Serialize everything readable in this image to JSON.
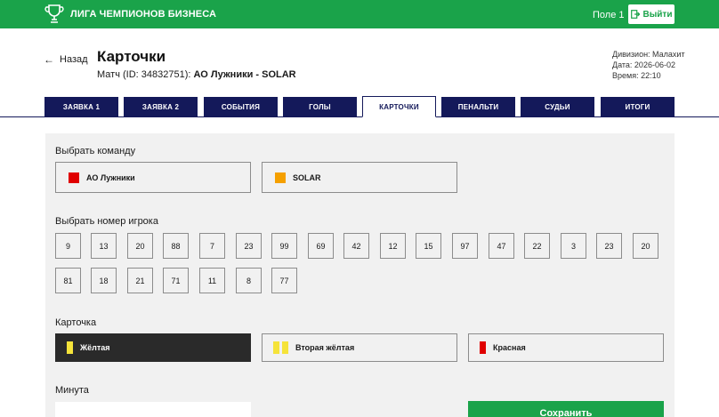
{
  "header": {
    "logo_text": "ЛИГА ЧЕМПИОНОВ БИЗНЕСА",
    "field_label": "Поле 1",
    "logout_label": "Выйти",
    "brand_color": "#1aa34a"
  },
  "page": {
    "back_label": "Назад",
    "title": "Карточки",
    "match_prefix": "Матч (ID: 34832751):",
    "match_teams": "АО Лужники - SOLAR",
    "division": "Дивизион: Малахит",
    "date": "Дата: 2026-06-02",
    "time": "Время: 22:10"
  },
  "tabs": [
    {
      "label": "ЗАЯВКА 1",
      "active": false
    },
    {
      "label": "ЗАЯВКА 2",
      "active": false
    },
    {
      "label": "СОБЫТИЯ",
      "active": false
    },
    {
      "label": "ГОЛЫ",
      "active": false
    },
    {
      "label": "КАРТОЧКИ",
      "active": true
    },
    {
      "label": "ПЕНАЛЬТИ",
      "active": false
    },
    {
      "label": "СУДЬИ",
      "active": false
    },
    {
      "label": "ИТОГИ",
      "active": false
    }
  ],
  "team_section": {
    "label": "Выбрать команду",
    "teams": [
      {
        "name": "АО Лужники",
        "color": "#e00000"
      },
      {
        "name": "SOLAR",
        "color": "#f5a000"
      }
    ]
  },
  "player_section": {
    "label": "Выбрать номер игрока",
    "numbers": [
      "9",
      "13",
      "20",
      "88",
      "7",
      "23",
      "99",
      "69",
      "42",
      "12",
      "15",
      "97",
      "47",
      "22",
      "3",
      "23",
      "20",
      "81",
      "18",
      "21",
      "71",
      "11",
      "8",
      "77"
    ]
  },
  "card_section": {
    "label": "Карточка",
    "cards": [
      {
        "label": "Жёлтая",
        "icon": "yellow-card-icon",
        "color": "#f5e33a",
        "active": true
      },
      {
        "label": "Вторая жёлтая",
        "icon": "second-yellow-card-icon",
        "color": "#f5e33a",
        "active": false
      },
      {
        "label": "Красная",
        "icon": "red-card-icon",
        "color": "#e00000",
        "active": false
      }
    ]
  },
  "minute_section": {
    "label": "Минута",
    "value": ""
  },
  "save_label": "Сохранить"
}
